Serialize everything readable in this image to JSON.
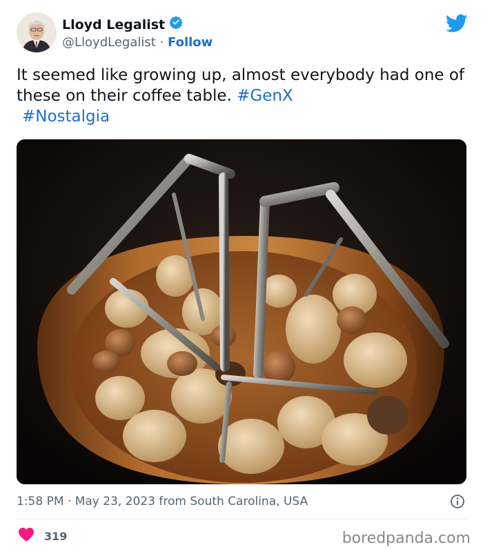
{
  "author": {
    "display_name": "Lloyd Legalist",
    "handle": "@LloydLegalist",
    "separator": "·",
    "follow_label": "Follow"
  },
  "tweet": {
    "text": "It seemed like growing up, almost everybody had one of these on their coffee table.",
    "hashtags": [
      "#GenX",
      "#Nostalgia"
    ]
  },
  "meta": {
    "time": "1:58 PM",
    "separator": "·",
    "date": "May 23, 2023",
    "location": "from South Carolina, USA"
  },
  "stats": {
    "likes": "319"
  },
  "watermark": "boredpanda.com",
  "colors": {
    "link": "#1d70c6",
    "verified": "#1d9bf0",
    "twitter_blue": "#1d9bf0",
    "like_red": "#f91880",
    "secondary_text": "#536471"
  },
  "icons": {
    "verified": "verified-badge-icon",
    "brand": "twitter-bird-icon",
    "info": "info-icon",
    "like": "heart-icon"
  }
}
